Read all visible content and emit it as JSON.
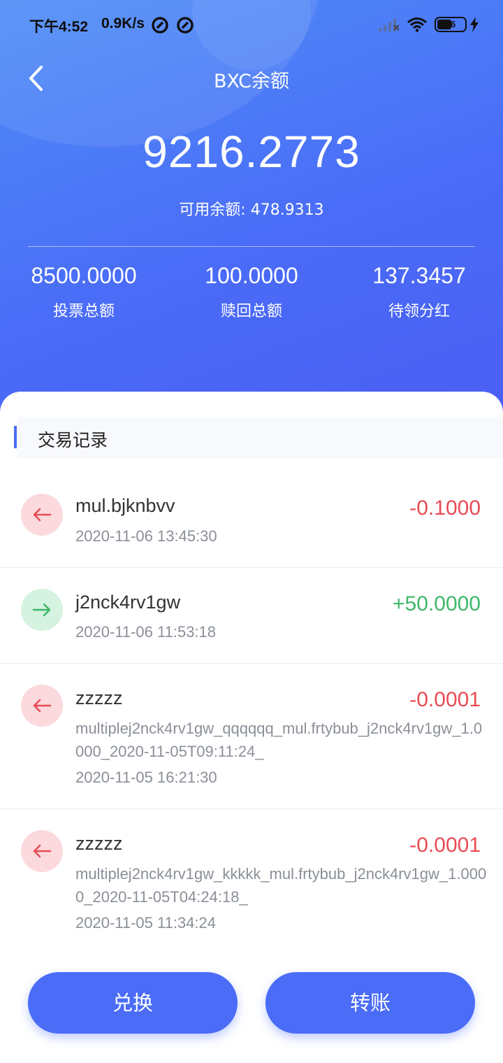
{
  "status_bar": {
    "time": "下午4:52",
    "speed": "0.9K/s",
    "battery": "36"
  },
  "header": {
    "title": "BXC余额",
    "total": "9216.2773",
    "available": "可用余额: 478.9313",
    "stats": [
      {
        "value": "8500.0000",
        "label": "投票总额"
      },
      {
        "value": "100.0000",
        "label": "赎回总额"
      },
      {
        "value": "137.3457",
        "label": "待领分红"
      }
    ]
  },
  "records": {
    "title": "交易记录",
    "items": [
      {
        "direction": "out",
        "name": "mul.bjknbvv",
        "memo": "",
        "time": "2020-11-06 13:45:30",
        "amount": "-0.1000"
      },
      {
        "direction": "in",
        "name": "j2nck4rv1gw",
        "memo": "",
        "time": "2020-11-06 11:53:18",
        "amount": "+50.0000"
      },
      {
        "direction": "out",
        "name": "zzzzz",
        "memo": "multiplej2nck4rv1gw_qqqqqq_mul.frtybub_j2nck4rv1gw_1.0000_2020-11-05T09:11:24_",
        "time": "2020-11-05 16:21:30",
        "amount": "-0.0001"
      },
      {
        "direction": "out",
        "name": "zzzzz",
        "memo": "multiplej2nck4rv1gw_kkkkk_mul.frtybub_j2nck4rv1gw_1.0000_2020-11-05T04:24:18_",
        "time": "2020-11-05 11:34:24",
        "amount": "-0.0001"
      }
    ]
  },
  "actions": {
    "exchange": "兑换",
    "transfer": "转账"
  },
  "colors": {
    "primary": "#4a6cf7",
    "out": "#e94b55",
    "in": "#3fb86a"
  }
}
